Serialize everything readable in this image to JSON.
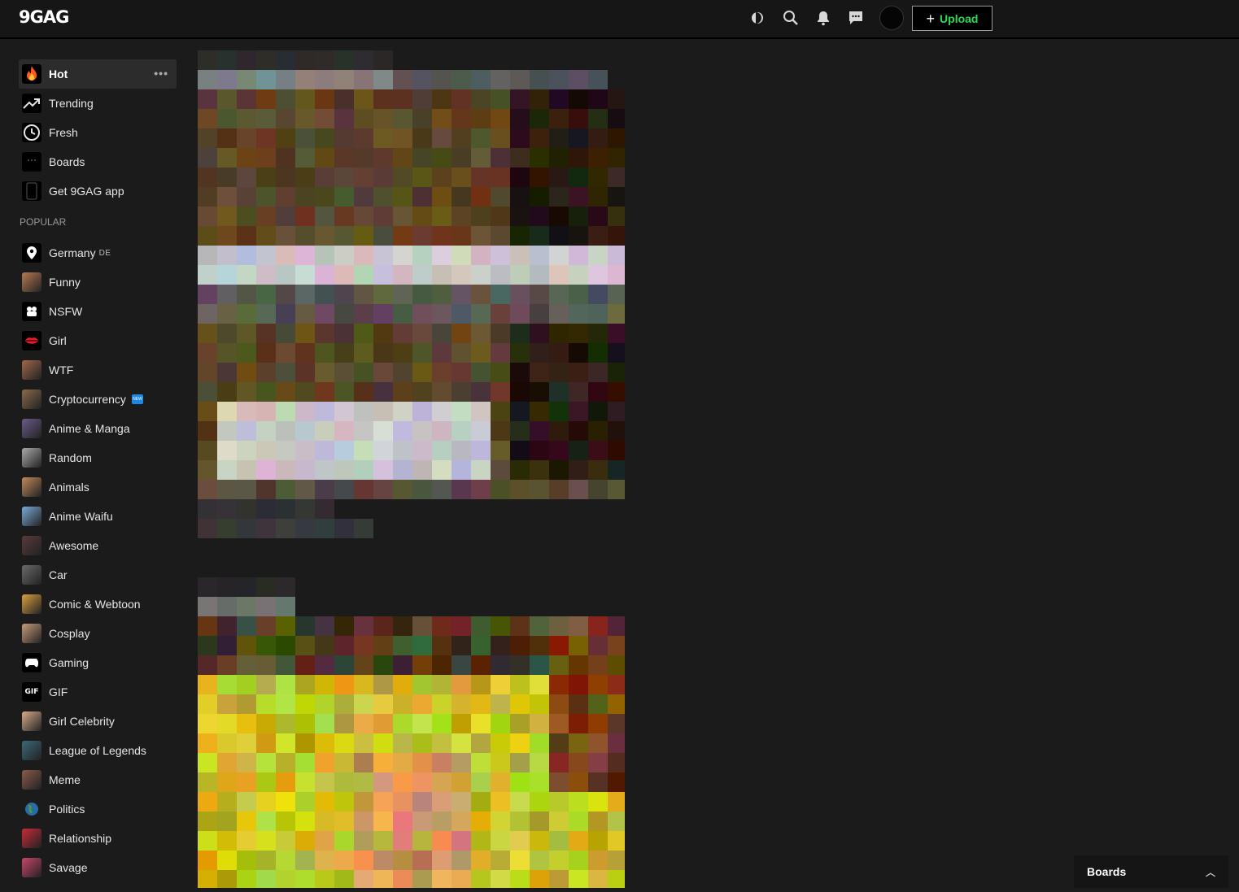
{
  "header": {
    "logo": "9GAG",
    "upload_label": "Upload",
    "icons": [
      "moon-icon",
      "search-icon",
      "bell-icon",
      "chat-icon"
    ]
  },
  "sidebar": {
    "main_items": [
      {
        "label": "Hot",
        "icon": "fire-icon",
        "active": true
      },
      {
        "label": "Trending",
        "icon": "trending-icon"
      },
      {
        "label": "Fresh",
        "icon": "clock-icon"
      },
      {
        "label": "Boards",
        "icon": "boards-icon"
      },
      {
        "label": "Get 9GAG app",
        "icon": "phone-icon"
      }
    ],
    "more_glyph": "•••",
    "section_title": "POPULAR",
    "popular": [
      {
        "label": "Germany",
        "tag": "DE",
        "icon": "location-pin-icon",
        "color": "#000000"
      },
      {
        "label": "Funny",
        "icon": "funny-thumb",
        "color": "#b87a52"
      },
      {
        "label": "NSFW",
        "icon": "nsfw-icon",
        "color": "#000000"
      },
      {
        "label": "Girl",
        "icon": "lips-icon",
        "color": "#000000"
      },
      {
        "label": "WTF",
        "icon": "wtf-thumb",
        "color": "#a0684a"
      },
      {
        "label": "Cryptocurrency",
        "icon": "crypto-thumb",
        "color": "#8a6a4a",
        "badge": "NEW"
      },
      {
        "label": "Anime & Manga",
        "icon": "anime-thumb",
        "color": "#6a5a8a"
      },
      {
        "label": "Random",
        "icon": "random-thumb",
        "color": "#aaaaaa"
      },
      {
        "label": "Animals",
        "icon": "animals-thumb",
        "color": "#c08a5a"
      },
      {
        "label": "Anime Waifu",
        "icon": "waifu-thumb",
        "color": "#7aaad8"
      },
      {
        "label": "Awesome",
        "icon": "awesome-thumb",
        "color": "#5a3a3a"
      },
      {
        "label": "Car",
        "icon": "car-thumb",
        "color": "#6a6a6a"
      },
      {
        "label": "Comic & Webtoon",
        "icon": "comic-thumb",
        "color": "#d8a040"
      },
      {
        "label": "Cosplay",
        "icon": "cosplay-thumb",
        "color": "#c89a7a"
      },
      {
        "label": "Gaming",
        "icon": "gamepad-icon",
        "color": "#000000"
      },
      {
        "label": "GIF",
        "icon": "gif-icon",
        "color": "#000000"
      },
      {
        "label": "Girl Celebrity",
        "icon": "celebrity-thumb",
        "color": "#d8aa8a"
      },
      {
        "label": "League of Legends",
        "icon": "lol-thumb",
        "color": "#3a6a7a"
      },
      {
        "label": "Meme",
        "icon": "meme-thumb",
        "color": "#8a5a4a"
      },
      {
        "label": "Politics",
        "icon": "globe-icon",
        "color": "#2a6aaa"
      },
      {
        "label": "Relationship",
        "icon": "heart-thumb",
        "color": "#c82a3a"
      },
      {
        "label": "Savage",
        "icon": "savage-thumb",
        "color": "#c8466a"
      }
    ]
  },
  "boards_panel": {
    "label": "Boards"
  },
  "colors": {
    "accent_green": "#2adb55",
    "background": "#1b1b1b"
  }
}
